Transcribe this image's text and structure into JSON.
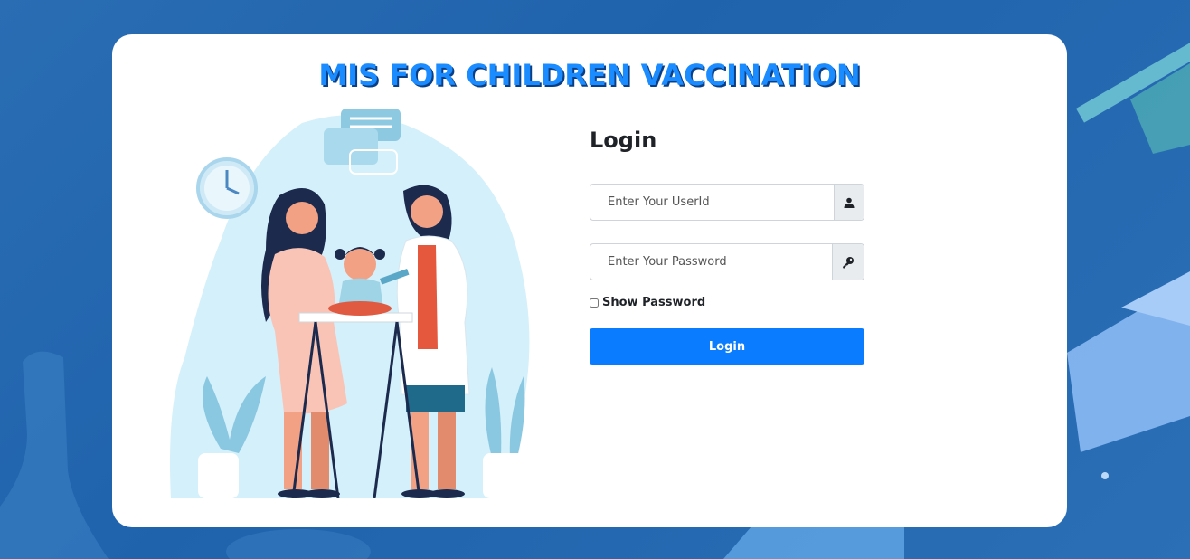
{
  "app": {
    "title": "MIS FOR CHILDREN VACCINATION"
  },
  "login": {
    "heading": "Login",
    "userid_placeholder": "Enter Your UserId",
    "password_placeholder": "Enter Your Password",
    "show_password_label": "Show Password",
    "submit_label": "Login"
  },
  "icons": {
    "userid_addon": "user-icon",
    "password_addon": "key-icon"
  },
  "colors": {
    "background": "#2467b0",
    "title": "#1a8cff",
    "button": "#0a7cff",
    "illustration_blob": "#d4f0fa"
  }
}
